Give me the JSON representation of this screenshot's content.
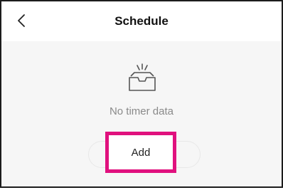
{
  "header": {
    "back_icon": "chevron-left-icon",
    "title": "Schedule"
  },
  "empty_state": {
    "icon": "empty-inbox-icon",
    "message": "No timer data"
  },
  "actions": {
    "add_label": "Add"
  },
  "colors": {
    "highlight": "#e0117e",
    "background": "#f6f6f6",
    "text_muted": "#8a8a8a"
  }
}
